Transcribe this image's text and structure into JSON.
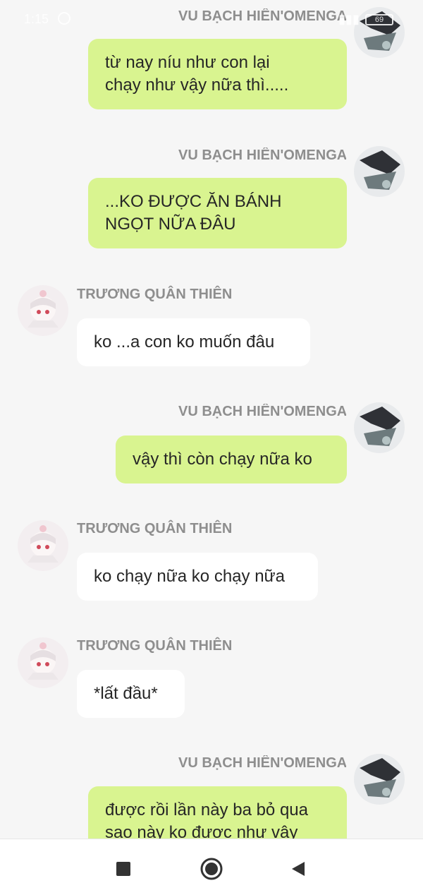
{
  "status_bar": {
    "time": "1:15",
    "battery": "69"
  },
  "messages": [
    {
      "side": "out",
      "name": "VU BẠCH HIÊN'OMENGA'",
      "lines": [
        "từ nay níu như con lại",
        "chạy như vậy nữa thì....."
      ]
    },
    {
      "side": "out",
      "name": "VU BẠCH HIÊN'OMENGA'",
      "lines": [
        "...KO ĐƯỢC ĂN BÁNH",
        "NGỌT NỮA ĐÂU"
      ]
    },
    {
      "side": "in",
      "name": "TRƯƠNG QUÂN THIÊN",
      "lines": [
        "ko ...a con ko muốn đâu"
      ]
    },
    {
      "side": "out",
      "name": "VU BẠCH HIÊN'OMENGA'",
      "lines": [
        "vậy thì còn chạy nữa ko"
      ]
    },
    {
      "side": "in",
      "name": "TRƯƠNG QUÂN THIÊN",
      "lines": [
        "ko chạy nữa ko chạy nữa"
      ]
    },
    {
      "side": "in",
      "name": "TRƯƠNG QUÂN THIÊN",
      "lines": [
        "*lất đầu*"
      ]
    },
    {
      "side": "out",
      "name": "VU BẠCH HIÊN'OMENGA'",
      "lines": [
        "được rồi lần này ba bỏ qua",
        "sao này ko được như vậy"
      ]
    }
  ],
  "colors": {
    "outgoing_bubble": "#d9f490",
    "incoming_bubble": "#ffffff",
    "background": "#f6f6f6"
  },
  "nav": {
    "recents": "stop-square-icon",
    "home": "home-circle-icon",
    "back": "back-triangle-icon"
  }
}
